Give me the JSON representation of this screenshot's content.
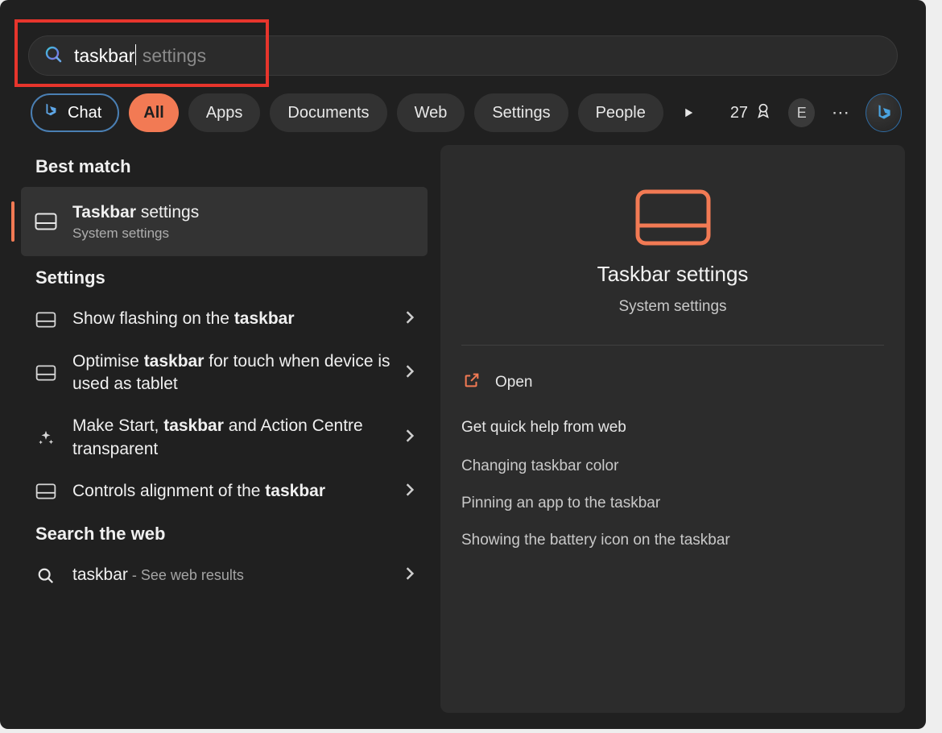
{
  "search": {
    "typed": "taskbar",
    "suggest": " settings"
  },
  "filters": {
    "chat": "Chat",
    "items": [
      "All",
      "Apps",
      "Documents",
      "Web",
      "Settings",
      "People"
    ],
    "active_index": 0
  },
  "toolbar": {
    "rewards_points": "27",
    "avatar_initial": "E"
  },
  "left": {
    "best_match_label": "Best match",
    "best": {
      "title_prefix": "Taskbar",
      "title_suffix": " settings",
      "subtitle": "System settings"
    },
    "settings_label": "Settings",
    "settings_items": [
      {
        "pre": "Show flashing on the ",
        "bold": "taskbar",
        "post": ""
      },
      {
        "pre": "Optimise ",
        "bold": "taskbar",
        "post": " for touch when device is used as tablet"
      },
      {
        "pre": "Make Start, ",
        "bold": "taskbar",
        "post": " and Action Centre transparent"
      },
      {
        "pre": "Controls alignment of the ",
        "bold": "taskbar",
        "post": ""
      }
    ],
    "web_label": "Search the web",
    "web": {
      "term": "taskbar",
      "suffix": " - See web results"
    }
  },
  "right": {
    "hero_title": "Taskbar settings",
    "hero_sub": "System settings",
    "open_label": "Open",
    "help_title": "Get quick help from web",
    "help_links": [
      "Changing taskbar color",
      "Pinning an app to the taskbar",
      "Showing the battery icon on the taskbar"
    ]
  },
  "colors": {
    "accent": "#f27a54",
    "highlight": "#e7352c"
  }
}
